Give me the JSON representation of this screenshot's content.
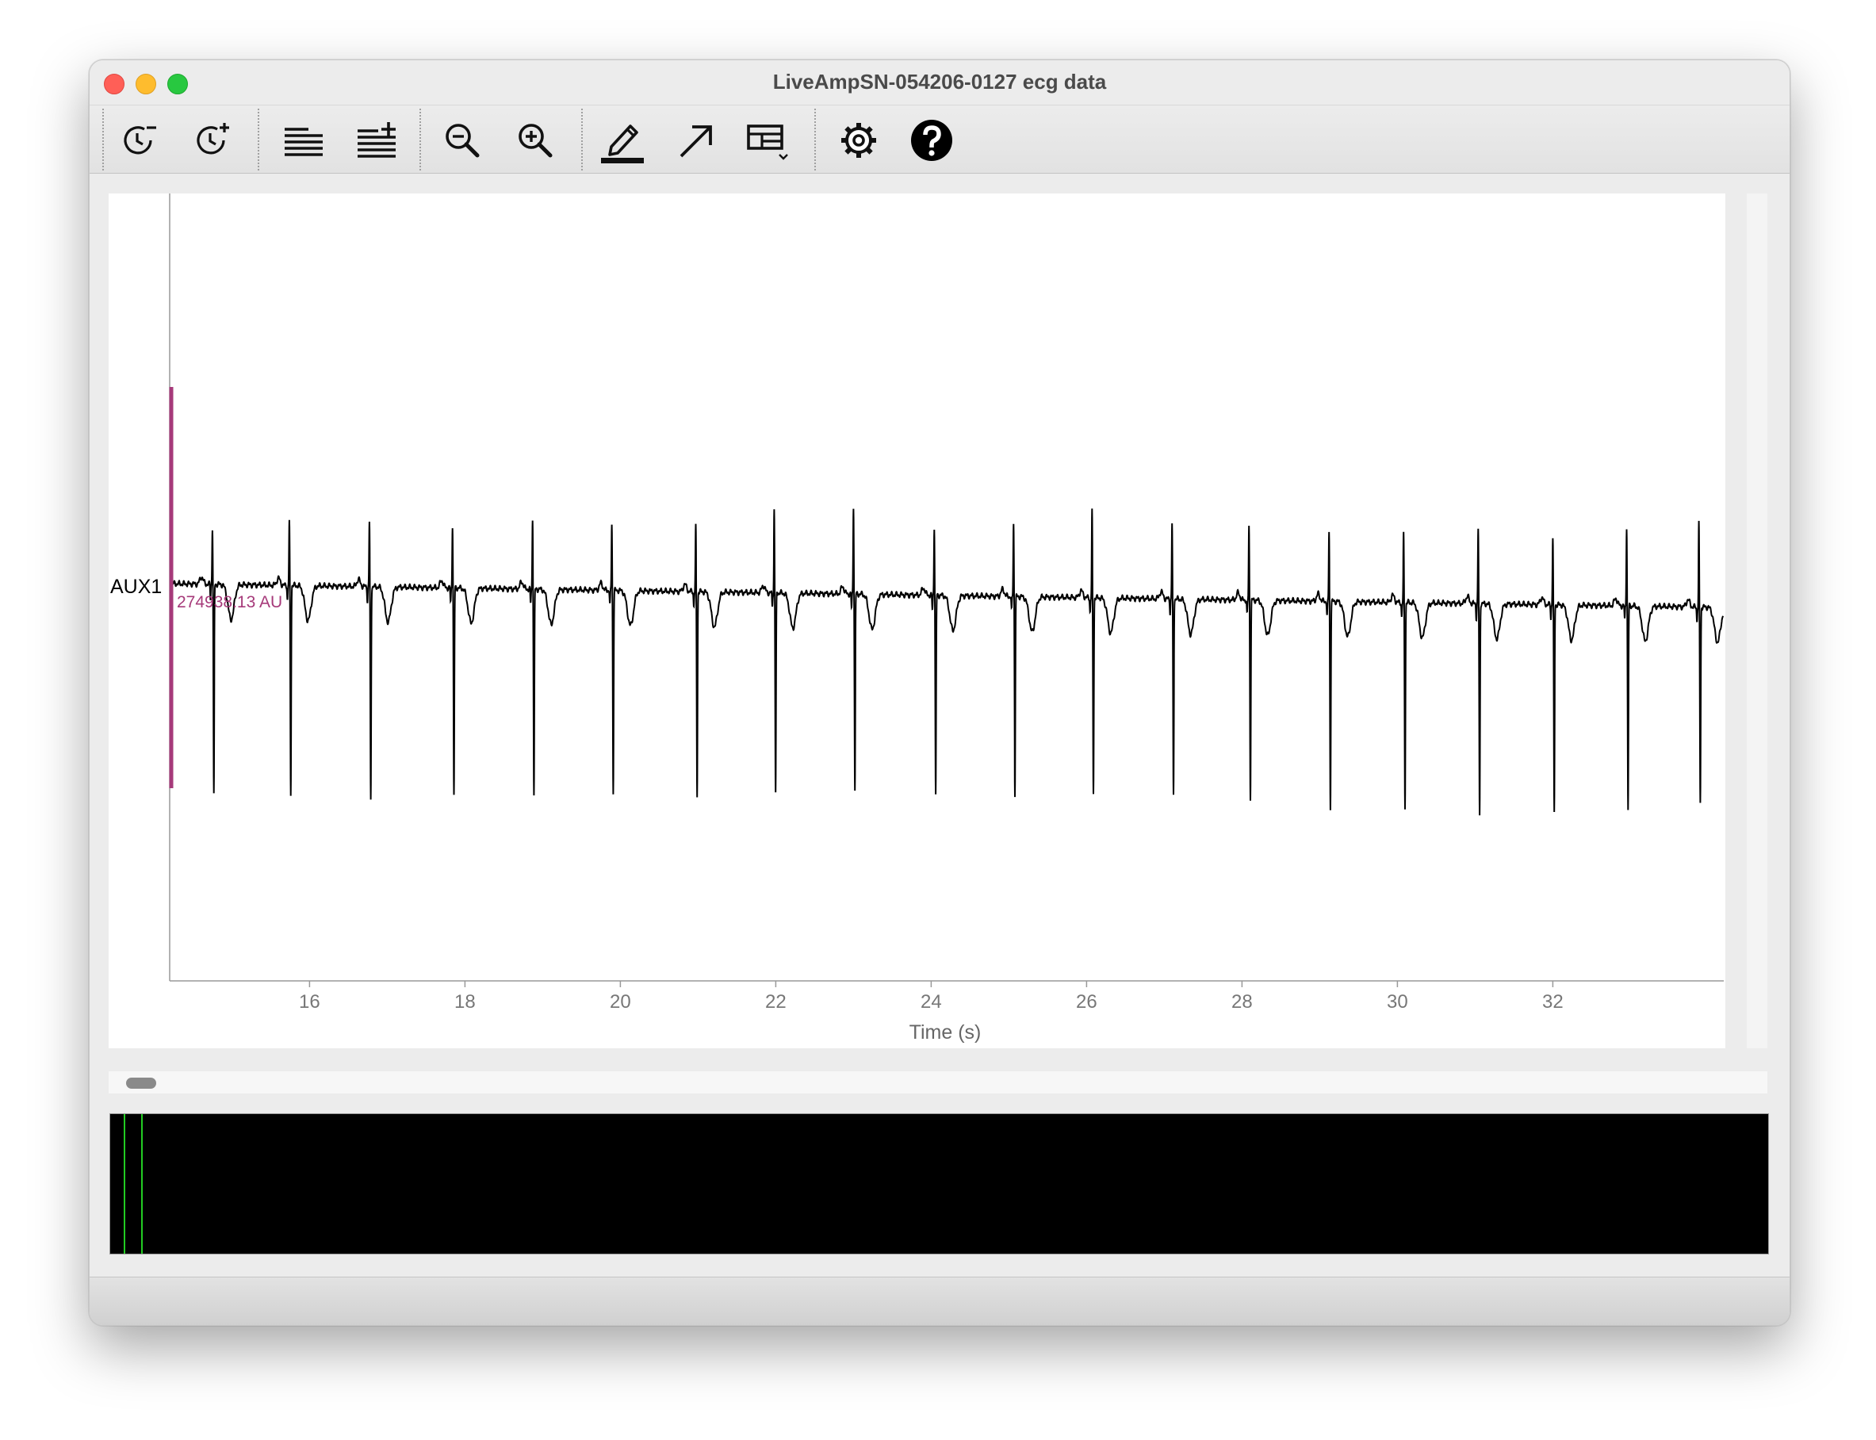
{
  "window": {
    "title": "LiveAmpSN-054206-0127 ecg data"
  },
  "toolbar": {
    "tools": [
      {
        "name": "decrease-time-scale",
        "icon": "clock-minus-icon"
      },
      {
        "name": "increase-time-scale",
        "icon": "clock-plus-icon"
      },
      {
        "name": "decrease-channels",
        "icon": "lines-minus-icon"
      },
      {
        "name": "increase-channels",
        "icon": "lines-plus-icon"
      },
      {
        "name": "zoom-out",
        "icon": "zoom-out-icon"
      },
      {
        "name": "zoom-in",
        "icon": "zoom-in-icon"
      },
      {
        "name": "annotate",
        "icon": "pencil-icon"
      },
      {
        "name": "arrow",
        "icon": "arrow-icon"
      },
      {
        "name": "layout",
        "icon": "layout-icon"
      },
      {
        "name": "settings",
        "icon": "gear-icon"
      },
      {
        "name": "help",
        "icon": "help-icon"
      }
    ]
  },
  "plot": {
    "channel_label": "AUX1",
    "scale_label": "274938.13 AU",
    "x_axis_label": "Time (s)",
    "x_ticks": [
      "16",
      "18",
      "20",
      "22",
      "24",
      "26",
      "28",
      "30",
      "32"
    ],
    "colors": {
      "trace": "#000000",
      "scale_bar": "#a63a7a",
      "overview_window": "#22cc22"
    }
  },
  "chart_data": {
    "type": "line",
    "xlabel": "Time (s)",
    "ylabel": "",
    "xlim": [
      14.2,
      34.2
    ],
    "series": [
      {
        "name": "AUX1"
      }
    ],
    "r_peaks_s": [
      14.75,
      15.74,
      16.77,
      17.84,
      18.87,
      19.89,
      20.97,
      21.98,
      23.0,
      24.04,
      25.06,
      26.07,
      27.1,
      28.09,
      29.12,
      30.08,
      31.04,
      32.0,
      32.95,
      33.88
    ]
  }
}
